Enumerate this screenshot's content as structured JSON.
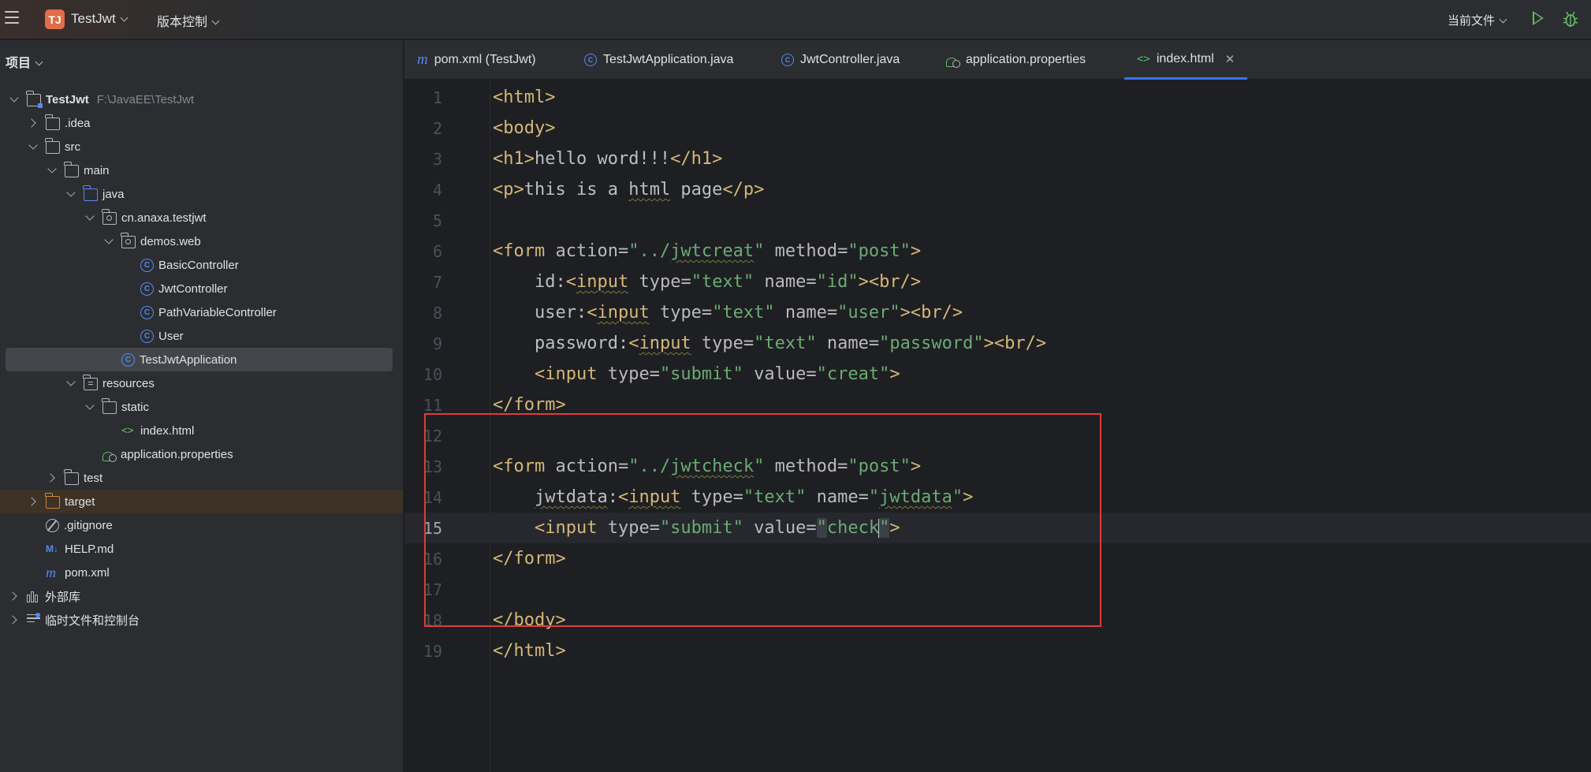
{
  "titlebar": {
    "project_badge": "TJ",
    "project_name": "TestJwt",
    "vcs_label": "版本控制",
    "current_file_label": "当前文件"
  },
  "sidebar": {
    "header": "项目",
    "tree": [
      {
        "label": "TestJwt",
        "extra": "F:\\JavaEE\\TestJwt"
      },
      {
        "label": ".idea"
      },
      {
        "label": "src"
      },
      {
        "label": "main"
      },
      {
        "label": "java"
      },
      {
        "label": "cn.anaxa.testjwt"
      },
      {
        "label": "demos.web"
      },
      {
        "label": "BasicController"
      },
      {
        "label": "JwtController"
      },
      {
        "label": "PathVariableController"
      },
      {
        "label": "User"
      },
      {
        "label": "TestJwtApplication"
      },
      {
        "label": "resources"
      },
      {
        "label": "static"
      },
      {
        "label": "index.html"
      },
      {
        "label": "application.properties"
      },
      {
        "label": "test"
      },
      {
        "label": "target"
      },
      {
        "label": ".gitignore"
      },
      {
        "label": "HELP.md"
      },
      {
        "label": "pom.xml"
      },
      {
        "label": "外部库"
      },
      {
        "label": "临时文件和控制台"
      }
    ],
    "icons": {
      "class_letter": "C",
      "markdown_badge": "M↓",
      "maven_letter": "m",
      "html_glyph": "<>"
    }
  },
  "tabs": [
    {
      "label": "pom.xml (TestJwt)",
      "icon": "maven-icon"
    },
    {
      "label": "TestJwtApplication.java",
      "icon": "spring-class-icon"
    },
    {
      "label": "JwtController.java",
      "icon": "class-icon"
    },
    {
      "label": "application.properties",
      "icon": "properties-icon"
    },
    {
      "label": "index.html",
      "icon": "html-icon",
      "active": true
    }
  ],
  "editor": {
    "current_line": 15,
    "line_numbers": [
      "1",
      "2",
      "3",
      "4",
      "5",
      "6",
      "7",
      "8",
      "9",
      "10",
      "11",
      "12",
      "13",
      "14",
      "15",
      "16",
      "17",
      "18",
      "19"
    ],
    "code": {
      "l1": {
        "t1": "<html>"
      },
      "l2": {
        "t1": "<body>"
      },
      "l3": {
        "t1": "<h1>",
        "txt": "hello word!!!",
        "t2": "</h1>"
      },
      "l4": {
        "t1": "<p>",
        "txt1": "this is a ",
        "txt2": "html",
        "txt3": " page",
        "t2": "</p>"
      },
      "l6": {
        "t1": "<form ",
        "a1": "action=",
        "s1a": "\"../",
        "s1b": "jwtcreat",
        "s1c": "\"",
        "a2": " method=",
        "s2": "\"post\"",
        "t2": ">"
      },
      "l7": {
        "indent": "    ",
        "txt": "id:",
        "t1": "<",
        "t1b": "input",
        "a1": " type=",
        "s1": "\"text\"",
        "a2": " name=",
        "s2": "\"id\"",
        "t2": "><br/>"
      },
      "l8": {
        "indent": "    ",
        "txt": "user:",
        "t1": "<",
        "t1b": "input",
        "a1": " type=",
        "s1": "\"text\"",
        "a2": " name=",
        "s2": "\"user\"",
        "t2": "><br/>"
      },
      "l9": {
        "indent": "    ",
        "txt": "password:",
        "t1": "<",
        "t1b": "input",
        "a1": " type=",
        "s1": "\"text\"",
        "a2": " name=",
        "s2": "\"password\"",
        "t2": "><br/>"
      },
      "l10": {
        "indent": "    ",
        "t1": "<input ",
        "a1": "type=",
        "s1": "\"submit\"",
        "a2": " value=",
        "s2": "\"creat\"",
        "t2": ">"
      },
      "l11": {
        "t1": "</form>"
      },
      "l13": {
        "t1": "<form ",
        "a1": "action=",
        "s1a": "\"../",
        "s1b": "jwtcheck",
        "s1c": "\"",
        "a2": " method=",
        "s2": "\"post\"",
        "t2": ">"
      },
      "l14": {
        "indent": "    ",
        "txt": "jwtdata",
        "txt2": ":",
        "t1": "<",
        "t1b": "input",
        "a1": " type=",
        "s1": "\"text\"",
        "a2": " name=",
        "s2a": "\"",
        "s2b": "jwtdata",
        "s2c": "\"",
        "t2": ">"
      },
      "l15": {
        "indent": "    ",
        "t1": "<input ",
        "a1": "type=",
        "s1": "\"submit\"",
        "a2": " value=",
        "q1": "\"",
        "s2": "check",
        "q2": "\"",
        "t2": ">"
      },
      "l16": {
        "t1": "</form>"
      },
      "l18": {
        "t1": "</body>"
      },
      "l19": {
        "t1": "</html>"
      }
    }
  },
  "colors": {
    "tag": "#d5b778",
    "attribute": "#bababa",
    "string": "#6aab73",
    "annotation_box": "#e23a3a",
    "accent": "#3574f0"
  }
}
